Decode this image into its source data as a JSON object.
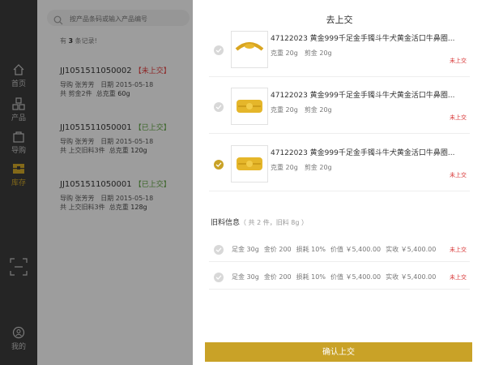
{
  "nav": {
    "items": [
      {
        "label": "首页",
        "icon": "home-icon"
      },
      {
        "label": "产品",
        "icon": "product-icon"
      },
      {
        "label": "导购",
        "icon": "shopping-bag-icon"
      },
      {
        "label": "库存",
        "icon": "inventory-icon"
      },
      {
        "label": "",
        "icon": "scan-icon"
      },
      {
        "label": "我的",
        "icon": "user-icon"
      }
    ],
    "active_color": "#c9a227"
  },
  "search": {
    "placeholder": "按产品条码或输入产品编号"
  },
  "list": {
    "count_prefix": "有",
    "count": "3",
    "count_suffix": "条记录!",
    "records": [
      {
        "id": "JJ1051511050002",
        "status": "【未上交】",
        "guide_label": "导购",
        "guide": "张芳芳",
        "date_label": "日期",
        "date": "2015-05-18",
        "line2": "共 剪金2件",
        "weight_label": "总克重",
        "weight": "60g"
      },
      {
        "id": "JJ1051511050001",
        "status": "【已上交】",
        "guide_label": "导购",
        "guide": "张芳芳",
        "date_label": "日期",
        "date": "2015-05-18",
        "line2": "共 上交旧料3件",
        "weight_label": "总克重",
        "weight": "120g"
      },
      {
        "id": "JJ1051511050001",
        "status": "【已上交】",
        "guide_label": "导购",
        "guide": "张芳芳",
        "date_label": "日期",
        "date": "2015-05-18",
        "line2": "共 上交旧料3件",
        "weight_label": "总克重",
        "weight": "128g"
      }
    ]
  },
  "modal": {
    "title": "去上交",
    "items": [
      {
        "title": "47122023 黄金999千足金手镯斗牛犬黄金活口牛鼻圈...",
        "weight": "克重 20g",
        "cut": "剪金 20g",
        "status": "未上交",
        "checked": false
      },
      {
        "title": "47122023 黄金999千足金手镯斗牛犬黄金活口牛鼻圈...",
        "weight": "克重 20g",
        "cut": "剪金 20g",
        "status": "未上交",
        "checked": false
      },
      {
        "title": "47122023 黄金999千足金手镯斗牛犬黄金活口牛鼻圈...",
        "weight": "克重 20g",
        "cut": "剪金 20g",
        "status": "未上交",
        "checked": true
      }
    ],
    "old_header": "旧料信息",
    "old_sub": "（ 共 2 件，旧料 8g ）",
    "old_items": [
      {
        "gold": "足金 30g",
        "price": "金价 200",
        "loss": "损耗 10%",
        "value": "价值 ￥5,400.00",
        "paid": "实收 ￥5,400.00",
        "status": "未上交"
      },
      {
        "gold": "足金 30g",
        "price": "金价 200",
        "loss": "损耗 10%",
        "value": "价值 ￥5,400.00",
        "paid": "实收 ￥5,400.00",
        "status": "未上交"
      }
    ],
    "confirm_label": "确认上交"
  }
}
